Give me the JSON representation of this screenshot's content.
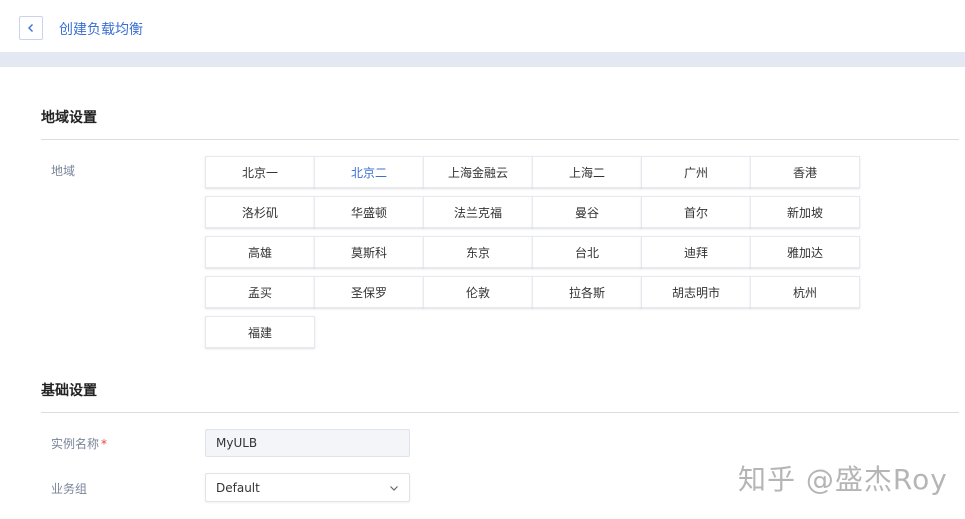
{
  "header": {
    "title": "创建负载均衡"
  },
  "region_section": {
    "title": "地域设置",
    "field_label": "地域",
    "selected": "北京二",
    "regions": [
      "北京一",
      "北京二",
      "上海金融云",
      "上海二",
      "广州",
      "香港",
      "洛杉矶",
      "华盛顿",
      "法兰克福",
      "曼谷",
      "首尔",
      "新加坡",
      "高雄",
      "莫斯科",
      "东京",
      "台北",
      "迪拜",
      "雅加达",
      "孟买",
      "圣保罗",
      "伦敦",
      "拉各斯",
      "胡志明市",
      "杭州",
      "福建"
    ]
  },
  "basic_section": {
    "title": "基础设置",
    "instance_name": {
      "label": "实例名称",
      "required_mark": "*",
      "value": "MyULB"
    },
    "business_group": {
      "label": "业务组",
      "value": "Default"
    }
  },
  "watermark": "知乎 @盛杰Roy",
  "colors": {
    "accent": "#3b6fd3",
    "banner": "#e3e8f3",
    "required": "#e64545"
  }
}
